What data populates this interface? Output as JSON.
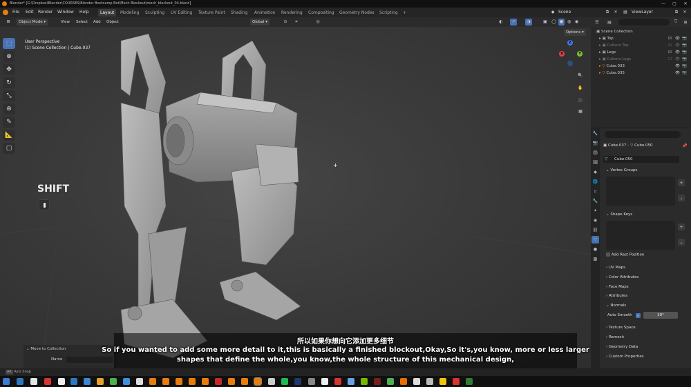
{
  "window": {
    "title": "Blender* [G:\\Dropbox\\Blender\\COURSES\\Blender Bootcamp Bot\\Mech Blockout\\mech_blockout_04.blend]",
    "controls": [
      "—",
      "▢",
      "✕"
    ]
  },
  "menu": {
    "items": [
      "File",
      "Edit",
      "Render",
      "Window",
      "Help"
    ],
    "workspaces": [
      "Layout",
      "Modeling",
      "Sculpting",
      "UV Editing",
      "Texture Paint",
      "Shading",
      "Animation",
      "Rendering",
      "Compositing",
      "Geometry Nodes",
      "Scripting",
      "+"
    ],
    "active_workspace": "Layout",
    "scene_label": "Scene",
    "viewlayer_label": "ViewLayer"
  },
  "header": {
    "mode": "Object Mode",
    "view_menu": [
      "View",
      "Select",
      "Add",
      "Object"
    ],
    "transform_orientation": "Global",
    "options_label": "Options"
  },
  "viewport": {
    "perspective_label": "User Perspective",
    "collection_label": "(1) Scene Collection | Cube.037",
    "key_overlay": "SHIFT"
  },
  "outliner": {
    "search_placeholder": "",
    "root": "Scene Collection",
    "items": [
      {
        "name": "Top",
        "dim": false
      },
      {
        "name": "Cutters Top",
        "dim": true
      },
      {
        "name": "Legs",
        "dim": false
      },
      {
        "name": "Cutters Legs",
        "dim": true
      },
      {
        "name": "Cube.033",
        "dim": false
      },
      {
        "name": "Cube.035",
        "dim": false
      }
    ]
  },
  "properties": {
    "breadcrumb_object": "Cube.037",
    "breadcrumb_mesh": "Cube.050",
    "mesh_name": "Cube.050",
    "sections": {
      "vertex_groups": "Vertex Groups",
      "shape_keys": "Shape Keys",
      "add_rest_position": "Add Rest Position",
      "uv_maps": "UV Maps",
      "color_attributes": "Color Attributes",
      "face_maps": "Face Maps",
      "attributes": "Attributes",
      "normals": "Normals",
      "auto_smooth": "Auto Smooth",
      "auto_smooth_angle": "30°",
      "texture_space": "Texture Space",
      "remesh": "Remesh",
      "geometry_data": "Geometry Data",
      "custom_properties": "Custom Properties"
    }
  },
  "operator_panel": {
    "title": "Move to Collection",
    "name_label": "Name"
  },
  "subtitles": {
    "chinese": "所以如果你想向它添加更多细节",
    "line1": "So if you wanted to add some more detail to it,this is basically a finished blockout,Okay,So it's,you know, more or less larger",
    "line2": "shapes that define the whole,you know,the whole structure of this mechanical design,"
  },
  "status": {
    "text": "Axis Snap"
  },
  "colors": {
    "accent": "#4772b3",
    "orange": "#e87d0d",
    "axis_x": "#e0424d",
    "axis_y": "#7fbf2a",
    "axis_z": "#3b7ce6"
  }
}
